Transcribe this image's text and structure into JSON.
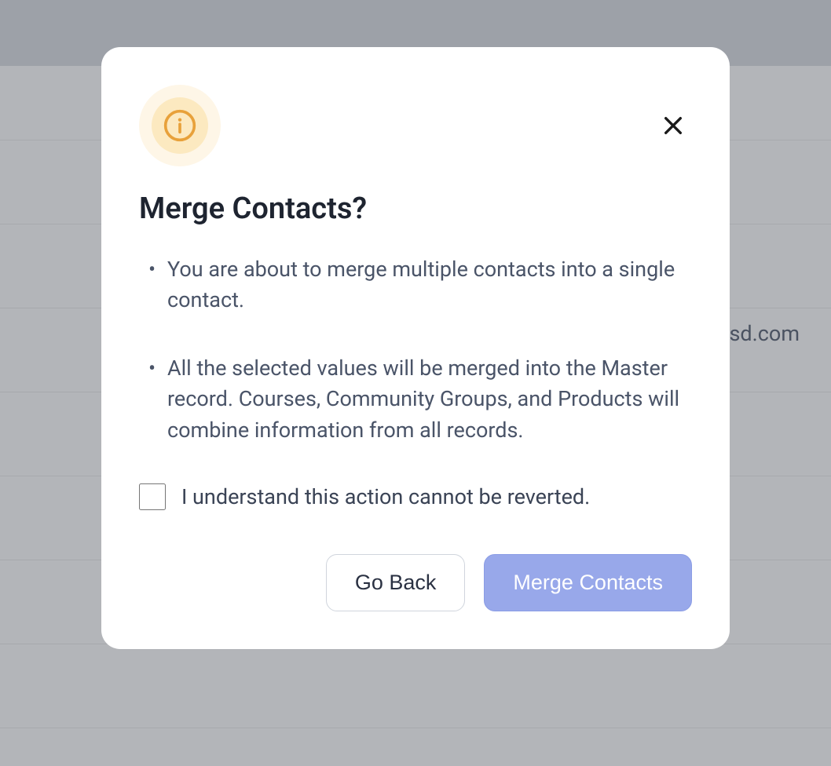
{
  "background": {
    "partial_email": "sd.com"
  },
  "modal": {
    "title": "Merge Contacts?",
    "bullets": [
      "You are about to merge multiple contacts into a single contact.",
      "All the selected values will be merged into the Master record. Courses, Community Groups, and Products will combine information from all records."
    ],
    "confirm_checkbox_label": "I understand this action cannot be reverted.",
    "buttons": {
      "go_back": "Go Back",
      "merge": "Merge Contacts"
    }
  }
}
